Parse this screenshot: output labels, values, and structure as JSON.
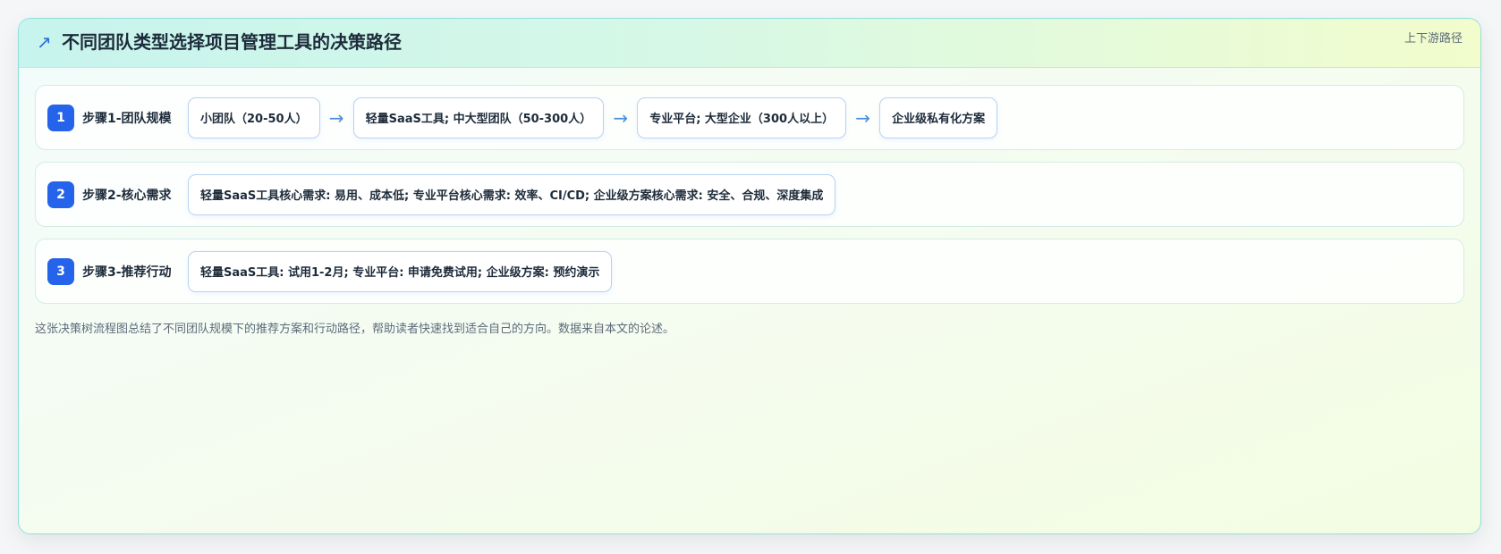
{
  "header": {
    "icon": "trend-arrow-icon",
    "icon_glyph": "↗",
    "title": "不同团队类型选择项目管理工具的决策路径",
    "tag": "上下游路径"
  },
  "steps": [
    {
      "number": "1",
      "label": "步骤1-团队规模",
      "nodes": [
        "小团队（20-50人）",
        "轻量SaaS工具; 中大型团队（50-300人）",
        "专业平台; 大型企业（300人以上）",
        "企业级私有化方案"
      ]
    },
    {
      "number": "2",
      "label": "步骤2-核心需求",
      "nodes": [
        "轻量SaaS工具核心需求: 易用、成本低; 专业平台核心需求: 效率、CI/CD; 企业级方案核心需求: 安全、合规、深度集成"
      ]
    },
    {
      "number": "3",
      "label": "步骤3-推荐行动",
      "nodes": [
        "轻量SaaS工具: 试用1-2月; 专业平台: 申请免费试用; 企业级方案: 预约演示"
      ]
    }
  ],
  "arrow_glyph": "→",
  "footnote": "这张决策树流程图总结了不同团队规模下的推荐方案和行动路径，帮助读者快速找到适合自己的方向。数据来自本文的论述。",
  "colors": {
    "accent": "#2563eb",
    "arrow": "#4a8fd9",
    "border": "#8fe0dc"
  }
}
